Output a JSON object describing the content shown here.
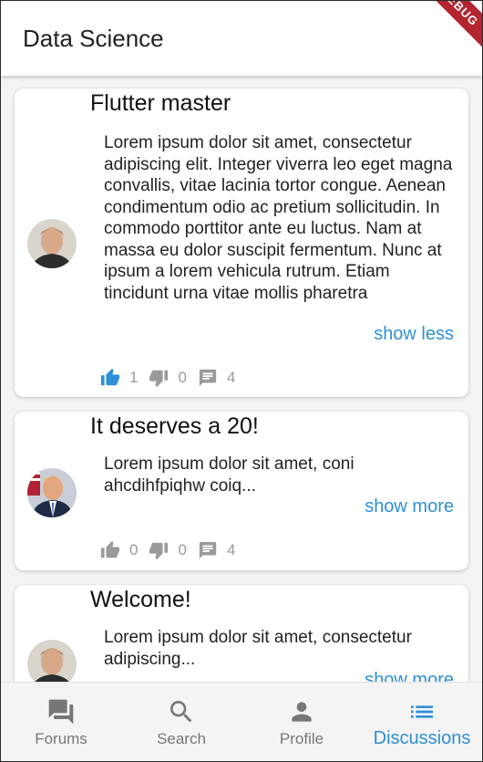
{
  "appbar": {
    "title": "Data Science",
    "debug_label": "DEBUG"
  },
  "posts": [
    {
      "title": "Flutter master",
      "body": "Lorem ipsum dolor sit amet, consectetur adipiscing elit. Integer viverra leo eget magna convallis, vitae lacinia tortor congue. Aenean condimentum odio ac pretium sollicitudin. In commodo porttitor ante eu luctus. Nam at massa eu dolor suscipit fermentum. Nunc at ipsum a lorem vehicula rutrum. Etiam tincidunt urna vitae mollis pharetra",
      "toggle": "show less",
      "likes": "1",
      "dislikes": "0",
      "comments": "4",
      "liked": true
    },
    {
      "title": "It deserves a 20!",
      "body": "Lorem ipsum dolor sit amet, coni ahcdihfpiqhw coiq...",
      "toggle": "show more",
      "likes": "0",
      "dislikes": "0",
      "comments": "4",
      "liked": false
    },
    {
      "title": "Welcome!",
      "body": "Lorem ipsum dolor sit amet, consectetur adipiscing...",
      "toggle": "show more"
    }
  ],
  "nav": {
    "forums": "Forums",
    "search": "Search",
    "profile": "Profile",
    "discussions": "Discussions"
  },
  "colors": {
    "accent": "#2e8fd6",
    "muted": "#9a9a9a",
    "debug": "#b3262f"
  }
}
